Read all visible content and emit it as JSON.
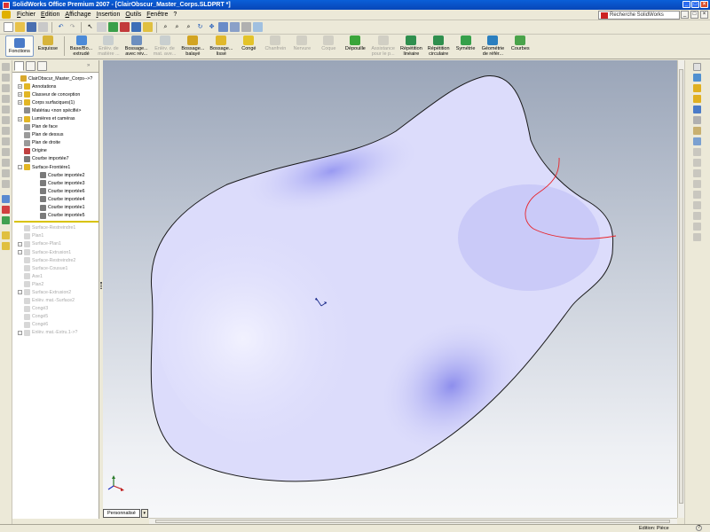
{
  "window": {
    "title": "SolidWorks Office Premium 2007 - [ClairObscur_Master_Corps.SLDPRT *]",
    "min_label": "_",
    "max_label": "□",
    "close_label": "×"
  },
  "menu": {
    "items": [
      "Fichier",
      "Edition",
      "Affichage",
      "Insertion",
      "Outils",
      "Fenêtre",
      "?"
    ],
    "search_placeholder": "Recherche SolidWorks",
    "right_buttons": [
      "_",
      "□",
      "×"
    ]
  },
  "command_manager": {
    "tabs": [
      {
        "label": "Fonctions",
        "active": true
      },
      {
        "label": "Esquisse",
        "active": false
      }
    ],
    "buttons": [
      {
        "label1": "Base/Bo...",
        "label2": "extrudé",
        "enabled": true,
        "color": "#4b8ad8"
      },
      {
        "label1": "Enlèv. de",
        "label2": "matière ...",
        "enabled": false,
        "color": "#8aa0c0"
      },
      {
        "label1": "Bossage...",
        "label2": "avec rév...",
        "enabled": true,
        "color": "#6d8fbf"
      },
      {
        "label1": "Enlèv. de",
        "label2": "mat. ave...",
        "enabled": false,
        "color": "#8aa0c0"
      },
      {
        "label1": "Bossage...",
        "label2": "balayé",
        "enabled": true,
        "color": "#d2a422"
      },
      {
        "label1": "Bossage...",
        "label2": "lissé",
        "enabled": true,
        "color": "#e0b82c"
      },
      {
        "label1": "Congé",
        "label2": "",
        "enabled": true,
        "color": "#e3c32a"
      },
      {
        "label1": "Chanfrein",
        "label2": "",
        "enabled": false,
        "color": "#a0a0a0"
      },
      {
        "label1": "Nervure",
        "label2": "",
        "enabled": false,
        "color": "#a0a0a0"
      },
      {
        "label1": "Coque",
        "label2": "",
        "enabled": false,
        "color": "#a0a0a0"
      },
      {
        "label1": "Dépouille",
        "label2": "",
        "enabled": true,
        "color": "#3aa53a"
      },
      {
        "label1": "Assistance",
        "label2": "pour le p...",
        "enabled": false,
        "color": "#a0a0a0"
      },
      {
        "label1": "Répétition",
        "label2": "linéaire",
        "enabled": true,
        "color": "#2f8f4e"
      },
      {
        "label1": "Répétition",
        "label2": "circulaire",
        "enabled": true,
        "color": "#2f8f4e"
      },
      {
        "label1": "Symétrie",
        "label2": "",
        "enabled": true,
        "color": "#36a04a"
      },
      {
        "label1": "Géométrie",
        "label2": "de référ...",
        "enabled": true,
        "color": "#2b7fbf"
      },
      {
        "label1": "Courbes",
        "label2": "",
        "enabled": true,
        "color": "#4aa34a"
      }
    ]
  },
  "feature_tree": {
    "items": [
      {
        "label": "ClairObscur_Master_Corps-->?",
        "indent": 0,
        "expander": "",
        "icon_color": "#d9a82c",
        "dim": false
      },
      {
        "label": "Annotations",
        "indent": 1,
        "expander": "+",
        "icon_color": "#e2b625",
        "dim": false
      },
      {
        "label": "Classeur de conception",
        "indent": 1,
        "expander": "+",
        "icon_color": "#e2b625",
        "dim": false
      },
      {
        "label": "Corps surfaciques(1)",
        "indent": 1,
        "expander": "+",
        "icon_color": "#e2b625",
        "dim": false
      },
      {
        "label": "Matériau <non spécifié>",
        "indent": 1,
        "expander": "",
        "icon_color": "#8c8c8c",
        "dim": false
      },
      {
        "label": "Lumières et caméras",
        "indent": 1,
        "expander": "+",
        "icon_color": "#e2b625",
        "dim": false
      },
      {
        "label": "Plan de face",
        "indent": 1,
        "expander": "",
        "icon_color": "#9a9a9a",
        "dim": false
      },
      {
        "label": "Plan de dessus",
        "indent": 1,
        "expander": "",
        "icon_color": "#9a9a9a",
        "dim": false
      },
      {
        "label": "Plan de droite",
        "indent": 1,
        "expander": "",
        "icon_color": "#9a9a9a",
        "dim": false
      },
      {
        "label": "Origine",
        "indent": 1,
        "expander": "",
        "icon_color": "#c04040",
        "dim": false
      },
      {
        "label": "Courbe importée7",
        "indent": 1,
        "expander": "",
        "icon_color": "#7a7a7a",
        "dim": false
      },
      {
        "label": "Surface-Frontière1",
        "indent": 1,
        "expander": "-",
        "icon_color": "#e2b625",
        "dim": false
      },
      {
        "label": "Courbe importée2",
        "indent": 2,
        "expander": "",
        "icon_color": "#7a7a7a",
        "dim": false
      },
      {
        "label": "Courbe importée3",
        "indent": 2,
        "expander": "",
        "icon_color": "#7a7a7a",
        "dim": false
      },
      {
        "label": "Courbe importée6",
        "indent": 2,
        "expander": "",
        "icon_color": "#7a7a7a",
        "dim": false
      },
      {
        "label": "Courbe importée4",
        "indent": 2,
        "expander": "",
        "icon_color": "#7a7a7a",
        "dim": false
      },
      {
        "label": "Courbe importée1",
        "indent": 2,
        "expander": "",
        "icon_color": "#7a7a7a",
        "dim": false
      },
      {
        "label": "Courbe importée5",
        "indent": 2,
        "expander": "",
        "icon_color": "#7a7a7a",
        "dim": false
      }
    ],
    "suppressed_items": [
      {
        "label": "Surface-Restreindre1",
        "expander": ""
      },
      {
        "label": "Plan1",
        "expander": ""
      },
      {
        "label": "Surface-Plan1",
        "expander": "+"
      },
      {
        "label": "Surface-Extrusion1",
        "expander": "+"
      },
      {
        "label": "Surface-Restreindre2",
        "expander": ""
      },
      {
        "label": "Surface-Cousue1",
        "expander": ""
      },
      {
        "label": "Axe1",
        "expander": ""
      },
      {
        "label": "Plan2",
        "expander": ""
      },
      {
        "label": "Surface-Extrusion2",
        "expander": "+"
      },
      {
        "label": "Enlèv. mat.-Surface2",
        "expander": ""
      },
      {
        "label": "Congé3",
        "expander": ""
      },
      {
        "label": "Congé5",
        "expander": ""
      },
      {
        "label": "Congé6",
        "expander": ""
      },
      {
        "label": "Enlèv. mat.-Extru.1->?",
        "expander": "+"
      }
    ]
  },
  "viewport": {
    "surface_color": "#dcdcfb",
    "surface_shade": "#8c8cec",
    "edge_color": "#1a1a1a",
    "curve_color": "#e8242a"
  },
  "bottom": {
    "sheet_tab": "Personnalisé",
    "sheet_dropdown": "▾"
  },
  "status": {
    "text": "Edition: Pièce",
    "help": "?"
  }
}
